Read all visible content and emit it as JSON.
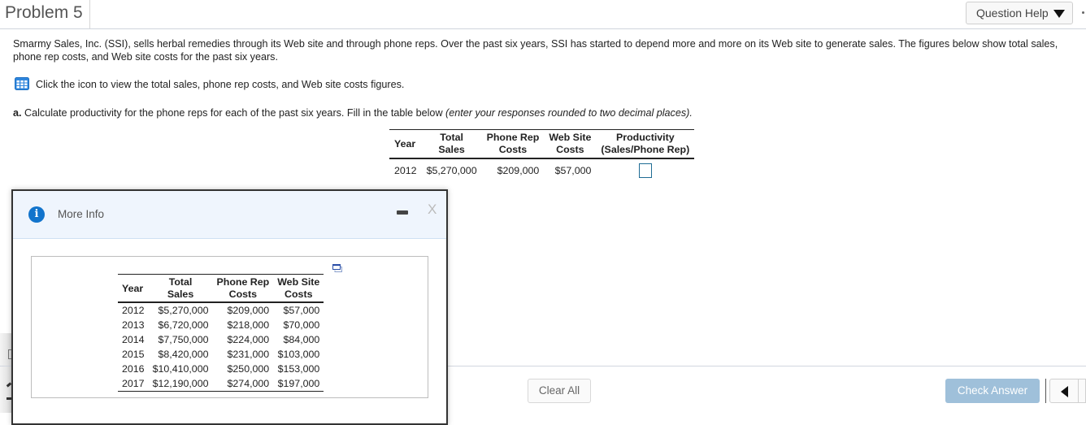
{
  "header": {
    "title": "Problem 5",
    "question_help_label": "Question Help"
  },
  "question": {
    "intro": "Smarmy Sales, Inc. (SSI), sells herbal remedies through its Web site and through phone reps. Over the past six years, SSI has started to depend more and more on its Web site to generate sales. The figures below show total sales, phone rep costs, and Web site costs for the past six years.",
    "icon_instruction": "Click the icon to view the total sales, phone rep costs, and Web site costs figures.",
    "part_a_label": "a.",
    "part_a_text": "Calculate productivity for the phone reps for each of the past six years. Fill in the table below",
    "part_a_hint": "(enter your responses rounded to two decimal places)."
  },
  "answer_table": {
    "headers": {
      "year": "Year",
      "total_sales": [
        "Total",
        "Sales"
      ],
      "phone_rep_costs": [
        "Phone Rep",
        "Costs"
      ],
      "web_site_costs": [
        "Web Site",
        "Costs"
      ],
      "productivity": [
        "Productivity",
        "(Sales/Phone Rep)"
      ]
    },
    "rows": [
      {
        "year": "2012",
        "total_sales": "$5,270,000",
        "phone_rep_costs": "$209,000",
        "web_site_costs": "$57,000",
        "productivity": ""
      }
    ]
  },
  "modal": {
    "title": "More Info",
    "close_label": "X",
    "table": {
      "headers": {
        "year": "Year",
        "total_sales": [
          "Total",
          "Sales"
        ],
        "phone_rep_costs": [
          "Phone Rep",
          "Costs"
        ],
        "web_site_costs": [
          "Web Site",
          "Costs"
        ]
      },
      "rows": [
        {
          "year": "2012",
          "total_sales": "$5,270,000",
          "phone_rep_costs": "$209,000",
          "web_site_costs": "$57,000"
        },
        {
          "year": "2013",
          "total_sales": "$6,720,000",
          "phone_rep_costs": "$218,000",
          "web_site_costs": "$70,000"
        },
        {
          "year": "2014",
          "total_sales": "$7,750,000",
          "phone_rep_costs": "$224,000",
          "web_site_costs": "$84,000"
        },
        {
          "year": "2015",
          "total_sales": "$8,420,000",
          "phone_rep_costs": "$231,000",
          "web_site_costs": "$103,000"
        },
        {
          "year": "2016",
          "total_sales": "$10,410,000",
          "phone_rep_costs": "$250,000",
          "web_site_costs": "$153,000"
        },
        {
          "year": "2017",
          "total_sales": "$12,190,000",
          "phone_rep_costs": "$274,000",
          "web_site_costs": "$197,000"
        }
      ]
    }
  },
  "footer": {
    "clear_all_label": "Clear All",
    "check_answer_label": "Check Answer"
  },
  "colors": {
    "accent_blue": "#1274cc",
    "check_button_disabled": "#9fc0da",
    "answer_box_border": "#1f6c94",
    "modal_header_bg": "#eff5fd"
  }
}
